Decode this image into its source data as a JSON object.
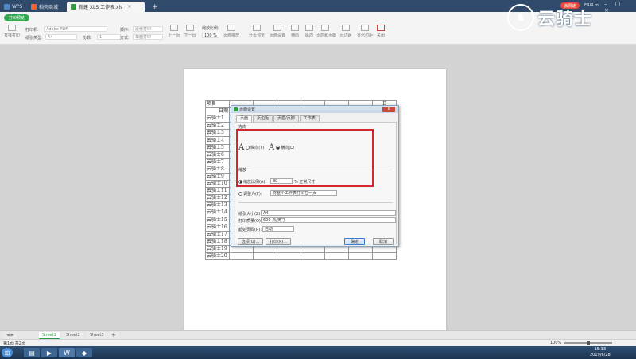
{
  "tabs": [
    {
      "label": "WPS",
      "icon": "wps-logo-icon"
    },
    {
      "label": "稻壳商城",
      "icon": "docer-icon"
    },
    {
      "label": "新建 XLS 工作表.xls",
      "icon": "spreadsheet-icon"
    }
  ],
  "new_tab_label": "+",
  "badge_label": "去限速",
  "user_label": "ERIR.m",
  "ribbon": {
    "mode_label": "打印预览",
    "printer_label": "打印机:",
    "printer_value": "Adobe PDF",
    "paper_label": "纸张类型:",
    "paper_value": "A4",
    "order_label": "顺序:",
    "order_value": "逐份打印",
    "copies_label": "份数:",
    "copies_value": "1",
    "method_label": "方式:",
    "method_value": "单面打印",
    "zoom_label": "缩放比例:",
    "zoom_value": "100 %",
    "page_zoom_label": "页面缩放",
    "direct_print_label": "直接打印",
    "prev_label": "上一页",
    "next_label": "下一页",
    "buttons": [
      "分页预览",
      "页面设置",
      "横向",
      "纵向",
      "页眉和页脚",
      "页边距",
      "显示边距",
      "关闭"
    ]
  },
  "logo": {
    "text": "云骑士"
  },
  "sheet": {
    "header_top": "项目",
    "header_bottom": "日期",
    "col_e": "E",
    "rows": [
      "云骑士1",
      "云骑士2",
      "云骑士3",
      "云骑士4",
      "云骑士5",
      "云骑士6",
      "云骑士7",
      "云骑士8",
      "云骑士9",
      "云骑士10",
      "云骑士11",
      "云骑士12",
      "云骑士13",
      "云骑士14",
      "云骑士15",
      "云骑士16",
      "云骑士17",
      "云骑士18",
      "云骑士19",
      "云骑士20"
    ]
  },
  "dialog": {
    "title": "页面设置",
    "close_label": "x",
    "tabs": [
      "页面",
      "页边距",
      "页眉/页脚",
      "工作表"
    ],
    "orientation_label": "方向",
    "portrait_label": "纵向(T)",
    "landscape_label": "横向(L)",
    "scaling_label": "缩放",
    "scale_label": "缩放比例(A):",
    "scale_value": "80",
    "scale_suffix": "% 正常尺寸",
    "fit_label": "调整为(F):",
    "fit_value": "将整个工作表打印在一页",
    "paper_size_label": "纸张大小(Z):",
    "paper_size_value": "A4",
    "print_quality_label": "打印质量(Q):",
    "print_quality_value": "600 点/英寸",
    "first_page_label": "起始页码(R):",
    "first_page_value": "自动",
    "options_button": "选项(O)...",
    "print_button": "打印(P)...",
    "ok_button": "确定",
    "cancel_button": "取消"
  },
  "sheet_tabs": [
    "Sheet1",
    "Sheet2",
    "Sheet3"
  ],
  "add_sheet_label": "+",
  "status": {
    "page_info": "第1页 共2页",
    "zoom": "100%"
  },
  "taskbar": {
    "time": "15:33",
    "date": "2019/6/28"
  },
  "colors": {
    "accent_green": "#33a853",
    "highlight_red": "#d5262e",
    "title_bar": "#2f4a6b"
  }
}
